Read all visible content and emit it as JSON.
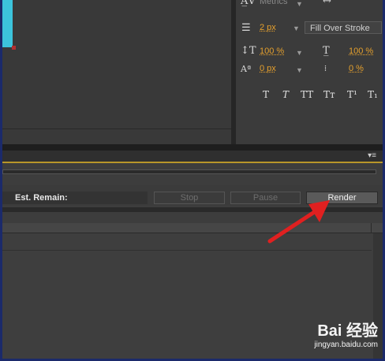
{
  "character_panel": {
    "kerning_value": "Metrics",
    "stroke_size": "2 px",
    "stroke_style": "Fill Over Stroke",
    "vertical_scale": "100 %",
    "horizontal_scale": "100 %",
    "baseline_shift": "0 px",
    "tsume": "0 %",
    "text_style_buttons": [
      "T",
      "T",
      "TT",
      "Tт",
      "T¹",
      "T₁"
    ]
  },
  "render_queue": {
    "est_remain_label": "Est. Remain:",
    "stop_label": "Stop",
    "pause_label": "Pause",
    "render_label": "Render"
  },
  "watermark": {
    "brand": "Bai 经验",
    "url": "jingyan.baidu.com"
  },
  "colors": {
    "accent_cyan": "#3cc4dc",
    "gold_line": "#b8962a",
    "value_orange": "#e5a02d",
    "annotation_arrow": "#e02020"
  }
}
